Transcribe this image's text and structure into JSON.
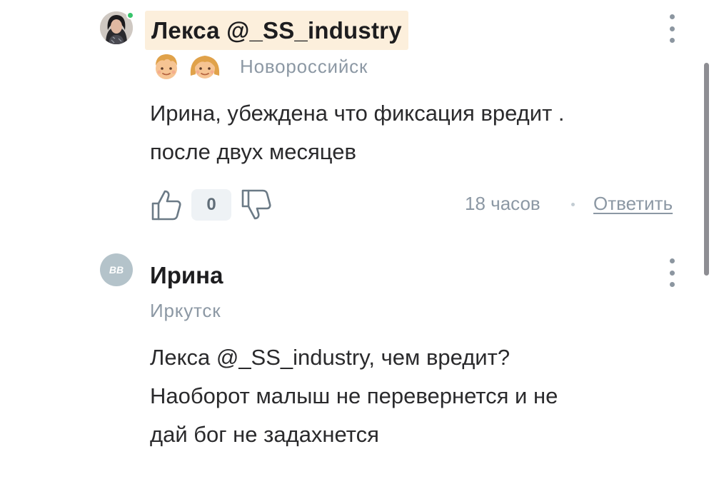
{
  "comments": [
    {
      "author": "Лекса @_SS_industry",
      "city": "Новороссийск",
      "badges": [
        "boy-emoji-icon",
        "girl-emoji-icon"
      ],
      "mention": "Ирина",
      "text_after_mention": ", убеждена что фиксация вредит .",
      "text_line2": "после двух месяцев",
      "likes": "0",
      "time": "18 часов",
      "reply_label": "Ответить"
    },
    {
      "author": "Ирина",
      "avatar_text": "BB",
      "city": "Иркутск",
      "mention": "Лекса @_SS_industry",
      "text_after_mention": ", чем вредит?",
      "text_line2": "Наоборот малыш не перевернется и не",
      "text_line3": "дай бог не задахнется"
    }
  ],
  "colors": {
    "author_highlight": "#fcefdc",
    "online": "#37c46b",
    "muted": "#8c98a4"
  }
}
